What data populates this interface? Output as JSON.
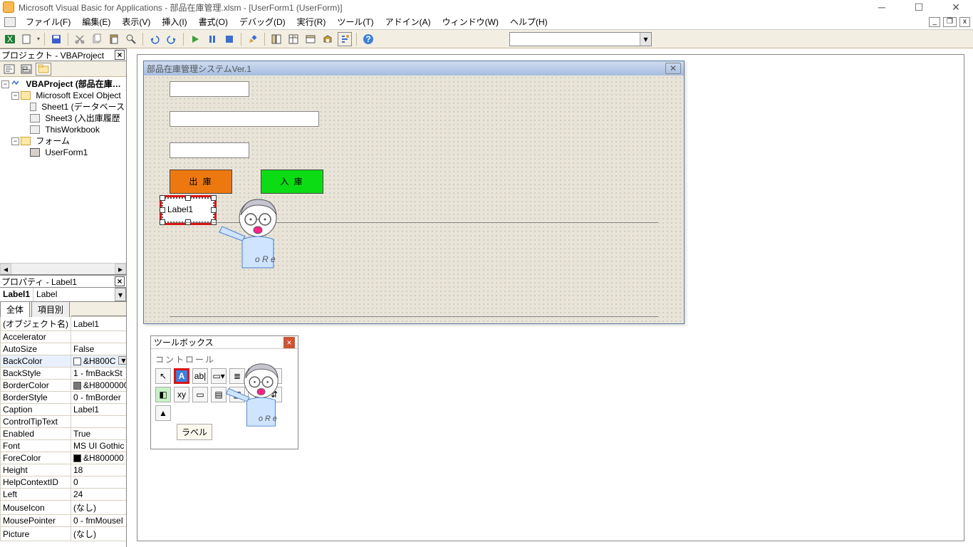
{
  "title": "Microsoft Visual Basic for Applications - 部品在庫管理.xlsm - [UserForm1 (UserForm)]",
  "menu": {
    "file": "ファイル(F)",
    "edit": "編集(E)",
    "view": "表示(V)",
    "insert": "挿入(I)",
    "format": "書式(O)",
    "debug": "デバッグ(D)",
    "run": "実行(R)",
    "tools": "ツール(T)",
    "addins": "アドイン(A)",
    "window": "ウィンドウ(W)",
    "help": "ヘルプ(H)"
  },
  "project_panel": {
    "title": "プロジェクト - VBAProject",
    "root": "VBAProject (部品在庫…",
    "objects_folder": "Microsoft Excel Object",
    "sheet1": "Sheet1 (データベース",
    "sheet3": "Sheet3 (入出庫履歴",
    "thiswb": "ThisWorkbook",
    "forms_folder": "フォーム",
    "userform": "UserForm1"
  },
  "props_panel": {
    "title": "プロパティ - Label1",
    "obj_name": "Label1",
    "obj_type": "Label",
    "tab_all": "全体",
    "tab_cat": "項目別",
    "rows": [
      {
        "k": "(オブジェクト名)",
        "v": "Label1"
      },
      {
        "k": "Accelerator",
        "v": ""
      },
      {
        "k": "AutoSize",
        "v": "False"
      },
      {
        "k": "BackColor",
        "v": "&H800C",
        "swatch": "#ffffff",
        "combo": true
      },
      {
        "k": "BackStyle",
        "v": "1 - fmBackSt"
      },
      {
        "k": "BorderColor",
        "v": "&H8000000",
        "swatch": "#777777"
      },
      {
        "k": "BorderStyle",
        "v": "0 - fmBorder"
      },
      {
        "k": "Caption",
        "v": "Label1"
      },
      {
        "k": "ControlTipText",
        "v": ""
      },
      {
        "k": "Enabled",
        "v": "True"
      },
      {
        "k": "Font",
        "v": "MS UI Gothic"
      },
      {
        "k": "ForeColor",
        "v": "&H800000",
        "swatch": "#000000"
      },
      {
        "k": "Height",
        "v": "18"
      },
      {
        "k": "HelpContextID",
        "v": "0"
      },
      {
        "k": "Left",
        "v": "24"
      },
      {
        "k": "MouseIcon",
        "v": "(なし)"
      },
      {
        "k": "MousePointer",
        "v": "0 - fmMouseI"
      },
      {
        "k": "Picture",
        "v": "(なし)"
      }
    ]
  },
  "userform": {
    "title": "部品在庫管理システムVer.1",
    "btn_out": "出 庫",
    "btn_in": "入 庫",
    "label_caption": "Label1"
  },
  "toolbox": {
    "title": "ツールボックス",
    "category": "コントロール",
    "hint": "ラベル"
  }
}
